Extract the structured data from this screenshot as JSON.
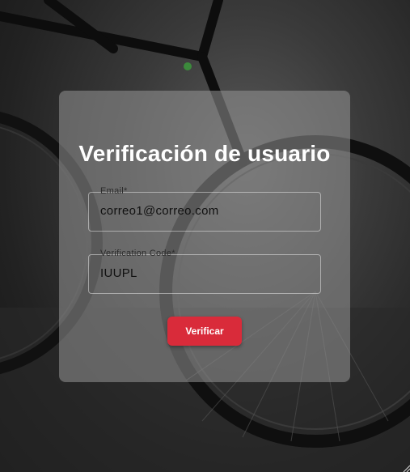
{
  "background": {
    "description_icon": "bicycle-background-image"
  },
  "form": {
    "title": "Verificación de usuario",
    "email": {
      "label": "Email*",
      "value": "correo1@correo.com"
    },
    "code": {
      "label": "Verification Code*",
      "value": "IUUPL"
    },
    "submit_label": "Verificar"
  },
  "colors": {
    "accent": "#d92b3a",
    "card": "rgba(150,150,150,0.55)",
    "title": "#ffffff"
  }
}
